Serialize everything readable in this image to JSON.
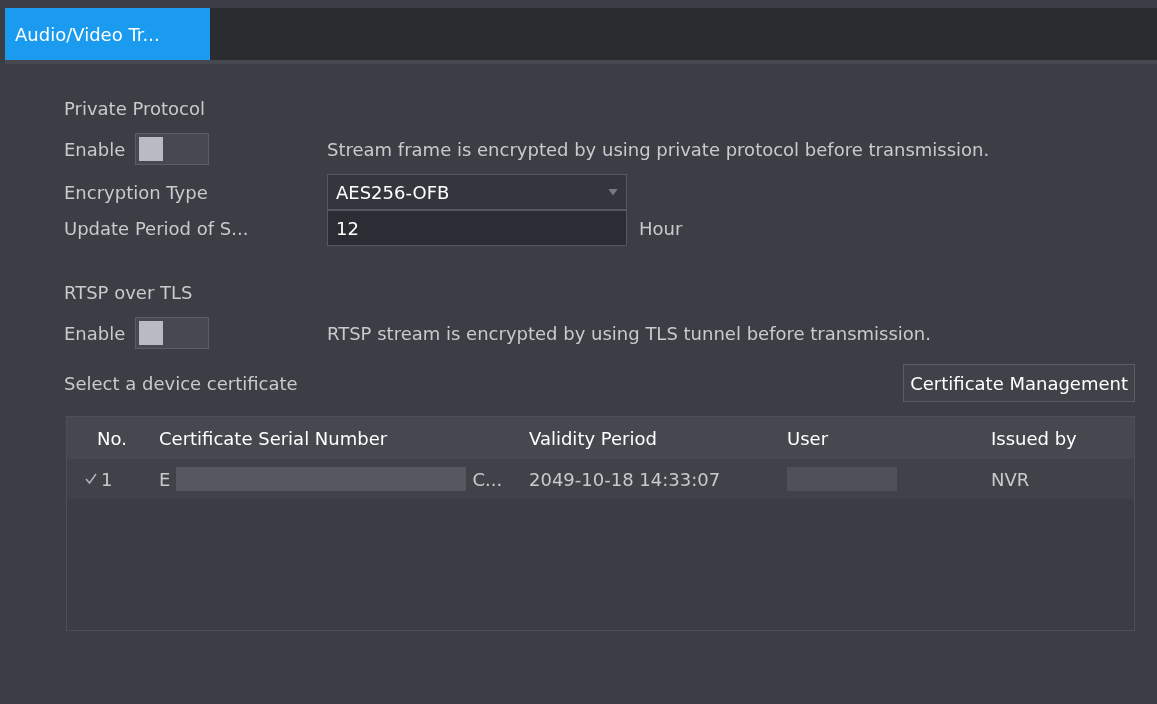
{
  "tabs": [
    {
      "label": "Audio/Video Tr...",
      "selected": true
    }
  ],
  "private_protocol": {
    "title": "Private Protocol",
    "enable_label": "Enable",
    "enabled": false,
    "description": "Stream frame is encrypted by using private protocol before transmission.",
    "encryption_type_label": "Encryption Type",
    "encryption_type": "AES256-OFB",
    "update_period_label": "Update Period of S...",
    "update_period": "12",
    "update_period_unit": "Hour"
  },
  "rtsp_over_tls": {
    "title": "RTSP over TLS",
    "enable_label": "Enable",
    "enabled": false,
    "description": "RTSP stream is encrypted by using TLS tunnel before transmission.",
    "select_label": "Select a device certificate",
    "manage_button": "Certificate Management"
  },
  "table": {
    "columns": [
      "No.",
      "Certificate Serial Number",
      "Validity Period",
      "User",
      "Issued by"
    ],
    "rows": [
      {
        "selected": true,
        "no": "1",
        "serial_start": "E",
        "serial_end": "C...",
        "validity": "2049-10-18 14:33:07",
        "issued_by": "NVR"
      }
    ]
  }
}
